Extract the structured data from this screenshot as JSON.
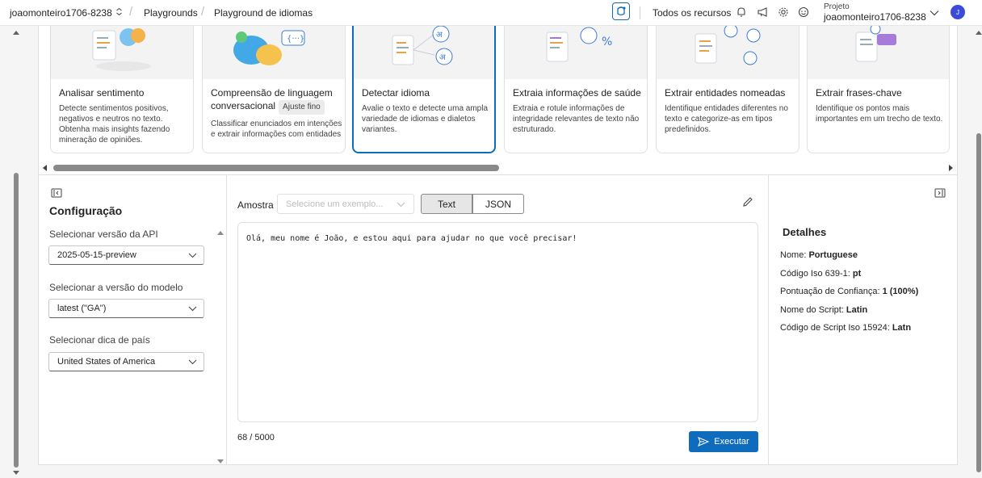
{
  "topbar": {
    "account": "joaomonteiro1706-8238",
    "breadcrumbs": [
      "Playgrounds",
      "Playground de idiomas"
    ],
    "all_resources": "Todos os recursos",
    "project_label": "Projeto",
    "project_name": "joaomonteiro1706-8238",
    "avatar_initial": "J"
  },
  "cards": [
    {
      "title": "Analisar sentimento",
      "badge": "",
      "description": "Detecte sentimentos positivos, negativos e neutros no texto. Obtenha mais insights fazendo mineração de opiniões."
    },
    {
      "title": "Compreensão de linguagem conversacional",
      "badge": "Ajuste fino",
      "description": "Classificar enunciados em intenções e extrair informações com entidades"
    },
    {
      "title": "Detectar idioma",
      "badge": "",
      "description": "Avalie o texto e detecte uma ampla variedade de idiomas e dialetos variantes."
    },
    {
      "title": "Extraia informações de saúde",
      "badge": "",
      "description": "Extraia e rotule informações de integridade relevantes de texto não estruturado."
    },
    {
      "title": "Extrair entidades nomeadas",
      "badge": "",
      "description": "Identifique entidades diferentes no texto e categorize-as em tipos predefinidos."
    },
    {
      "title": "Extrair frases-chave",
      "badge": "",
      "description": "Identifique os pontos mais importantes em um trecho de texto."
    }
  ],
  "config": {
    "title": "Configuração",
    "api_version_label": "Selecionar versão da API",
    "api_version_value": "2025-05-15-preview",
    "model_version_label": "Selecionar a versão do modelo",
    "model_version_value": "latest (\"GA\")",
    "country_hint_label": "Selecionar dica de país",
    "country_hint_value": "United States of America"
  },
  "editor": {
    "sample_label": "Amostra",
    "sample_placeholder": "Selecione um exemplo...",
    "tab_text": "Text",
    "tab_json": "JSON",
    "input_text": "Olá, meu nome é João, e estou aqui para ajudar no que você precisar!",
    "counter": "68 / 5000",
    "run_label": "Executar"
  },
  "details": {
    "title": "Detalhes",
    "rows": [
      {
        "label": "Nome: ",
        "value": "Portuguese"
      },
      {
        "label": "Código Iso 639-1: ",
        "value": "pt"
      },
      {
        "label": "Pontuação de Confiança: ",
        "value": "1 (100%)"
      },
      {
        "label": "Nome do Script: ",
        "value": "Latin"
      },
      {
        "label": "Código de Script Iso 15924: ",
        "value": "Latn"
      }
    ]
  },
  "colors": {
    "accent": "#0f6cbd",
    "avatar": "#3b4bd8"
  }
}
